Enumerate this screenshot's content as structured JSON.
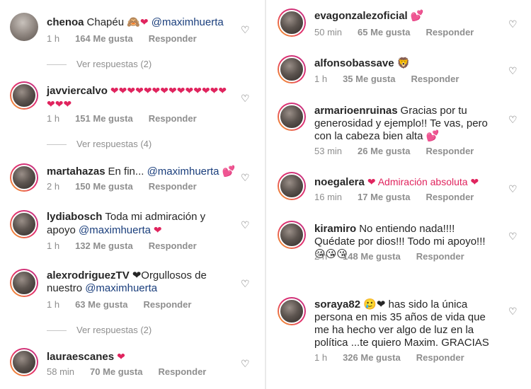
{
  "left": [
    {
      "user": "chenoa",
      "parts": [
        "Chapéu 🙈",
        "❤",
        " @maximhuerta"
      ],
      "time": "1 h",
      "likes": "164 Me gusta",
      "reply": "Responder",
      "replies": "Ver respuestas (2)"
    },
    {
      "user": "javviercalvo",
      "parts": [
        "",
        "❤❤❤❤❤❤❤❤❤❤❤❤❤❤❤❤❤",
        ""
      ],
      "time": "1 h",
      "likes": "151 Me gusta",
      "reply": "Responder",
      "replies": "Ver respuestas (4)"
    },
    {
      "user": "martahazas",
      "parts": [
        "En fin... ",
        "@maximhuerta",
        " 💕"
      ],
      "time": "2 h",
      "likes": "150 Me gusta",
      "reply": "Responder",
      "replies": ""
    },
    {
      "user": "lydiabosch",
      "parts": [
        "Toda mi admiración y apoyo ",
        "@maximhuerta",
        " ❤"
      ],
      "time": "1 h",
      "likes": "132 Me gusta",
      "reply": "Responder",
      "replies": ""
    },
    {
      "user": "alexrodriguezTV",
      "parts": [
        "❤Orgullosos de nuestro ",
        "@maximhuerta",
        ""
      ],
      "time": "1 h",
      "likes": "63 Me gusta",
      "reply": "Responder",
      "replies": "Ver respuestas (2)"
    },
    {
      "user": "lauraescanes",
      "parts": [
        "❤",
        "",
        ""
      ],
      "time": "58 min",
      "likes": "70 Me gusta",
      "reply": "Responder",
      "replies": ""
    }
  ],
  "right": [
    {
      "user": "evagonzalezoficial",
      "parts": [
        "💕",
        "",
        ""
      ],
      "time": "50 min",
      "likes": "65 Me gusta",
      "reply": "Responder"
    },
    {
      "user": "alfonsobassave",
      "parts": [
        "🦁",
        "",
        ""
      ],
      "time": "1 h",
      "likes": "35 Me gusta",
      "reply": "Responder"
    },
    {
      "user": "armarioenruinas",
      "parts": [
        "Gracias por tu generosidad y ejemplo!! Te vas, pero con la cabeza bien alta 💕",
        "",
        ""
      ],
      "time": "53 min",
      "likes": "26 Me gusta",
      "reply": "Responder"
    },
    {
      "user": "noegalera",
      "parts": [
        "❤ Admiración absoluta ❤",
        "",
        ""
      ],
      "time": "16 min",
      "likes": "17 Me gusta",
      "reply": "Responder"
    },
    {
      "user": "kiramiro",
      "parts": [
        "No entiendo nada!!!! Quédate por dios!!! Todo mi apoyo!!! 😘😘😘",
        "",
        ""
      ],
      "time": "2 h",
      "likes": "148 Me gusta",
      "reply": "Responder"
    },
    {
      "user": "soraya82",
      "parts": [
        "🥲❤ has sido la única persona en mis 35 años de vida que me ha hecho ver algo de luz en la política ...te quiero Maxim. GRACIAS",
        "",
        ""
      ],
      "time": "1 h",
      "likes": "326 Me gusta",
      "reply": "Responder"
    }
  ]
}
